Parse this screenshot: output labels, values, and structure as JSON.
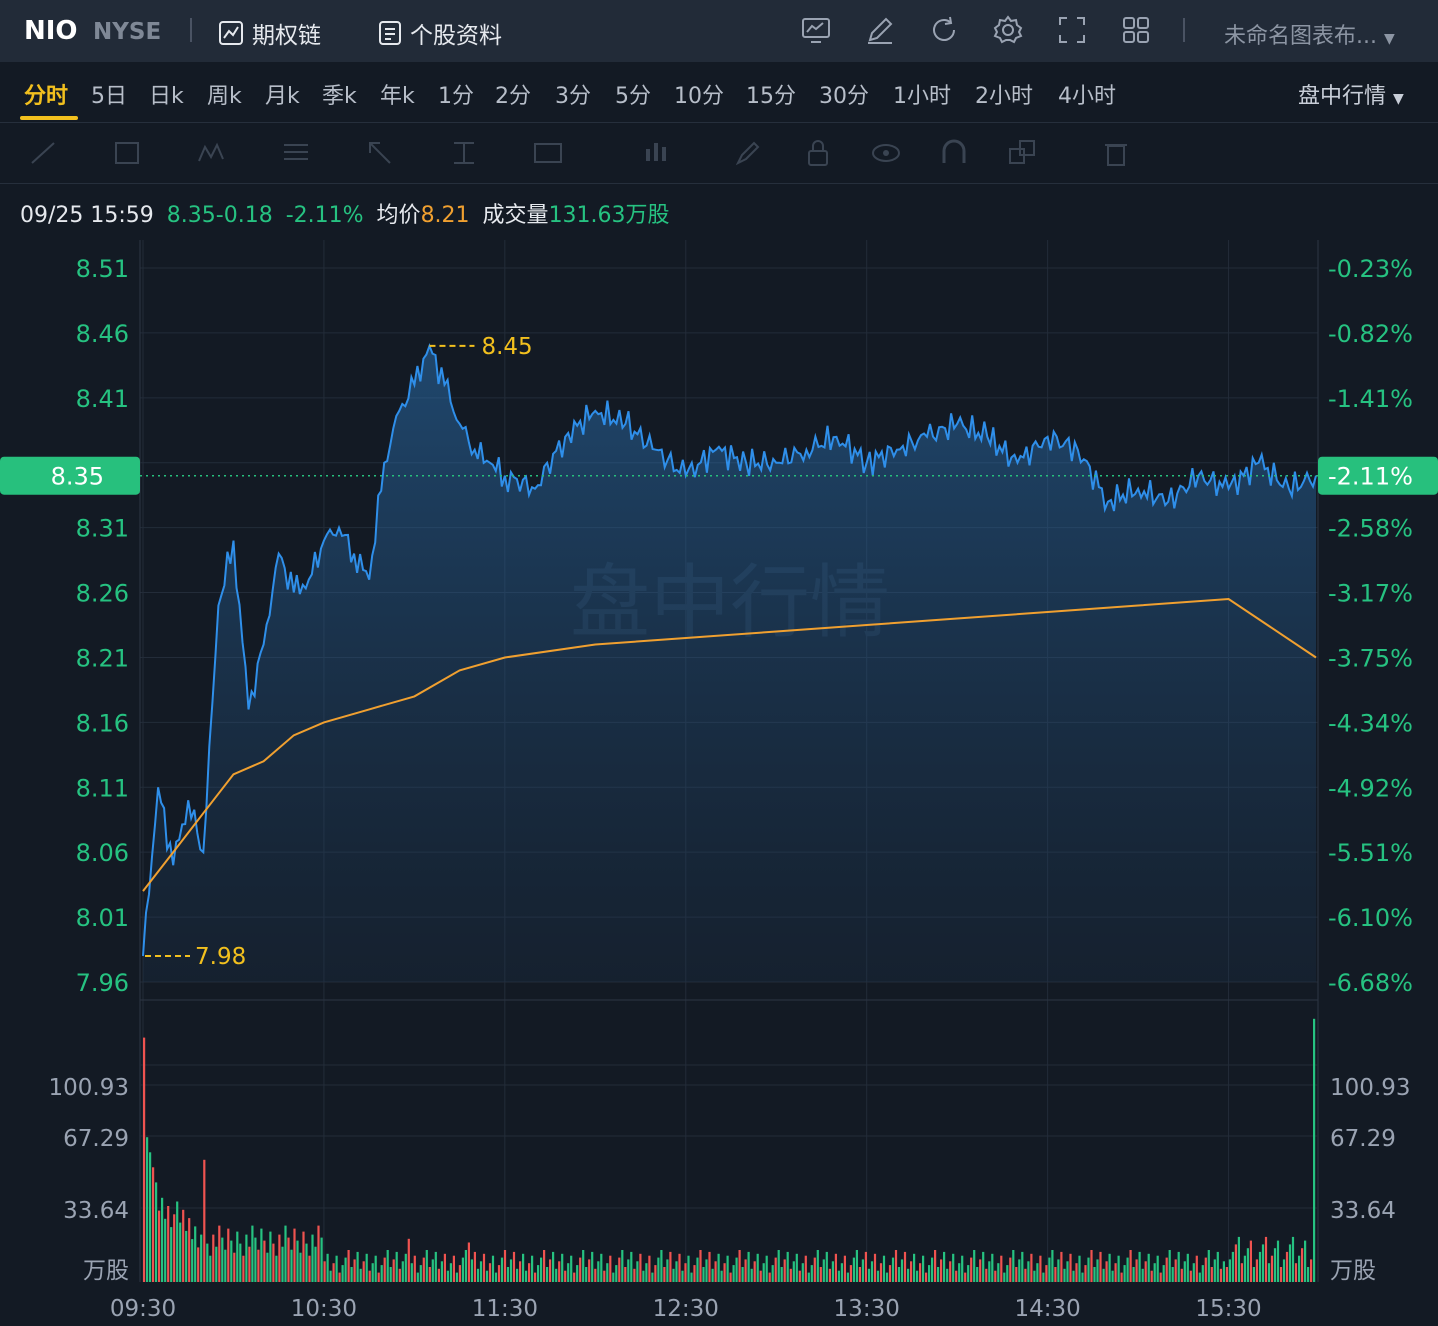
{
  "header": {
    "symbol": "NIO",
    "exchange": "NYSE",
    "options_chain_label": "期权链",
    "stock_profile_label": "个股资料",
    "layout_name": "未命名图表布..."
  },
  "timeframes": [
    "分时",
    "5日",
    "日k",
    "周k",
    "月k",
    "季k",
    "年k",
    "1分",
    "2分",
    "3分",
    "5分",
    "10分",
    "15分",
    "30分",
    "1小时",
    "2小时",
    "4小时"
  ],
  "active_timeframe": "分时",
  "session_label": "盘中行情",
  "info": {
    "datetime": "09/25 15:59",
    "price": "8.35",
    "change": "-0.18",
    "change_pct": "-2.11%",
    "avg_label": "均价",
    "avg_value": "8.21",
    "volume_label": "成交量",
    "volume_value": "131.63万股"
  },
  "watermark": "盘中行情",
  "colors": {
    "price_line": "#2f8fea",
    "avg_line": "#f0a030",
    "up": "#ef5350",
    "down": "#26c281",
    "accent": "#f2c01e",
    "badge": "#27c07d"
  },
  "chart_data": {
    "type": "line",
    "x_ticks": [
      "09:30",
      "10:30",
      "11:30",
      "12:30",
      "13:30",
      "14:30",
      "15:30"
    ],
    "price_axis": [
      "8.51",
      "8.46",
      "8.41",
      "8.36",
      "8.31",
      "8.26",
      "8.21",
      "8.16",
      "8.11",
      "8.06",
      "8.01",
      "7.96"
    ],
    "pct_axis": [
      "-0.23%",
      "-0.82%",
      "-1.41%",
      "-2.00%",
      "-2.58%",
      "-3.17%",
      "-3.75%",
      "-4.34%",
      "-4.92%",
      "-5.51%",
      "-6.10%",
      "-6.68%"
    ],
    "ylim": [
      7.96,
      8.51
    ],
    "prev_close": 8.53,
    "current_price": {
      "value": "8.35",
      "pct": "-2.11%"
    },
    "high": {
      "label": "8.45",
      "value": 8.45
    },
    "low": {
      "label": "7.98",
      "value": 7.98
    },
    "series": [
      {
        "name": "price",
        "x": [
          "09:30",
          "09:35",
          "09:40",
          "09:45",
          "09:50",
          "09:55",
          "10:00",
          "10:05",
          "10:10",
          "10:15",
          "10:20",
          "10:25",
          "10:30",
          "10:35",
          "10:40",
          "10:45",
          "10:50",
          "10:55",
          "11:00",
          "11:05",
          "11:10",
          "11:15",
          "11:20",
          "11:25",
          "11:30",
          "11:40",
          "11:50",
          "12:00",
          "12:10",
          "12:20",
          "12:30",
          "12:40",
          "12:50",
          "13:00",
          "13:10",
          "13:20",
          "13:30",
          "13:40",
          "13:50",
          "14:00",
          "14:10",
          "14:20",
          "14:30",
          "14:40",
          "14:50",
          "15:00",
          "15:10",
          "15:20",
          "15:30",
          "15:40",
          "15:50",
          "15:59"
        ],
        "values": [
          7.98,
          8.11,
          8.05,
          8.1,
          8.06,
          8.25,
          8.3,
          8.17,
          8.22,
          8.29,
          8.26,
          8.27,
          8.3,
          8.31,
          8.29,
          8.27,
          8.36,
          8.4,
          8.42,
          8.45,
          8.42,
          8.39,
          8.37,
          8.36,
          8.35,
          8.34,
          8.38,
          8.4,
          8.39,
          8.37,
          8.35,
          8.37,
          8.36,
          8.36,
          8.37,
          8.38,
          8.36,
          8.37,
          8.38,
          8.39,
          8.38,
          8.36,
          8.38,
          8.37,
          8.33,
          8.34,
          8.33,
          8.35,
          8.34,
          8.36,
          8.34,
          8.35
        ]
      },
      {
        "name": "average",
        "x": [
          "09:30",
          "09:40",
          "09:50",
          "10:00",
          "10:10",
          "10:20",
          "10:30",
          "10:45",
          "11:00",
          "11:15",
          "11:30",
          "12:00",
          "12:30",
          "13:00",
          "13:30",
          "14:00",
          "14:30",
          "15:00",
          "15:30",
          "15:59"
        ],
        "values": [
          8.03,
          8.06,
          8.09,
          8.12,
          8.13,
          8.15,
          8.16,
          8.17,
          8.18,
          8.2,
          8.21,
          8.22,
          8.225,
          8.23,
          8.235,
          8.24,
          8.245,
          8.25,
          8.255,
          8.21
        ]
      }
    ],
    "volume": {
      "unit_label": "万股",
      "axis_ticks": [
        "100.93",
        "67.29",
        "33.64"
      ],
      "ylim": [
        0,
        150
      ]
    }
  }
}
